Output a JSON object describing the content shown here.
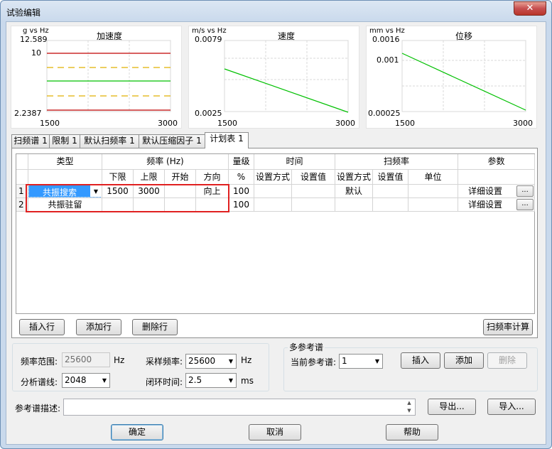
{
  "window": {
    "title": "试验编辑",
    "close": "✕"
  },
  "charts": [
    {
      "unit": "g vs Hz",
      "title": "加速度",
      "ymax": "12.589",
      "ymid": "10",
      "ymin": "2.2387",
      "xmin": "1500",
      "xmax": "3000"
    },
    {
      "unit": "m/s vs Hz",
      "title": "速度",
      "ymax": "0.0079",
      "ymin": "0.0025",
      "xmin": "1500",
      "xmax": "3000"
    },
    {
      "unit": "mm vs Hz",
      "title": "位移",
      "ymax": "0.0016",
      "ymid": "0.001",
      "ymin": "0.00025",
      "xmin": "1500",
      "xmax": "3000"
    }
  ],
  "colors": {
    "limit_red": "#c00000",
    "warn_yellow": "#e0b000",
    "profile_green": "#00c000",
    "selection_blue": "#3399ff",
    "highlight_red": "#e02020"
  },
  "tabs": [
    "扫频谱 1",
    "限制 1",
    "默认扫频率 1",
    "默认压缩因子 1",
    "计划表 1"
  ],
  "grid": {
    "header_top": [
      "类型",
      "频率 (Hz)",
      "量级",
      "时间",
      "扫频率",
      "参数"
    ],
    "header_sub": [
      "下限",
      "上限",
      "开始",
      "方向",
      "%",
      "设置方式",
      "设置值",
      "设置方式",
      "设置值",
      "单位"
    ],
    "rows": [
      {
        "num": "1",
        "type": "共振搜索",
        "lower": "1500",
        "upper": "3000",
        "start": "",
        "dir": "向上",
        "level": "100",
        "time_mode": "",
        "time_val": "",
        "sweep_mode": "默认",
        "sweep_val": "",
        "sweep_unit": "",
        "param": "详细设置",
        "param_btn": "..."
      },
      {
        "num": "2",
        "type": "共振驻留",
        "lower": "",
        "upper": "",
        "start": "",
        "dir": "",
        "level": "100",
        "time_mode": "",
        "time_val": "",
        "sweep_mode": "",
        "sweep_val": "",
        "sweep_unit": "",
        "param": "详细设置",
        "param_btn": "..."
      }
    ]
  },
  "row_buttons": {
    "insert": "插入行",
    "add": "添加行",
    "delete": "删除行",
    "calc": "扫频率计算"
  },
  "settings": {
    "freq_range_label": "频率范围:",
    "freq_range_value": "25600",
    "freq_range_unit": "Hz",
    "sample_rate_label": "采样频率:",
    "sample_rate_value": "25600",
    "sample_rate_unit": "Hz",
    "lines_label": "分析谱线:",
    "lines_value": "2048",
    "loop_time_label": "闭环时间:",
    "loop_time_value": "2.5",
    "loop_time_unit": "ms"
  },
  "multi_ref": {
    "title": "多参考谱",
    "current_label": "当前参考谱:",
    "current_value": "1",
    "insert": "插入",
    "add": "添加",
    "delete": "删除"
  },
  "ref_desc": {
    "label": "参考谱描述:",
    "value": "",
    "export": "导出...",
    "import": "导入..."
  },
  "footer": {
    "ok": "确定",
    "cancel": "取消",
    "help": "帮助"
  }
}
